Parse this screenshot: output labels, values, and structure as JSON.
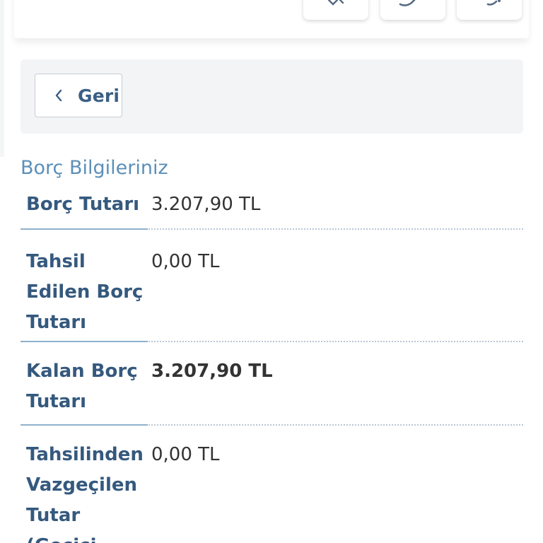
{
  "header": {
    "icons": [
      "star-icon",
      "chat-icon",
      "settings-icon"
    ]
  },
  "back": {
    "label": "Geri"
  },
  "section": {
    "title": "Borç Bilgileriniz"
  },
  "debt_rows": [
    {
      "label": "Borç Tutarı",
      "value": "3.207,90 TL",
      "emphasis": false
    },
    {
      "label": "Tahsil Edilen Borç Tutarı",
      "value": "0,00 TL",
      "emphasis": false
    },
    {
      "label": "Kalan Borç Tutarı",
      "value": "3.207,90 TL",
      "emphasis": true
    },
    {
      "label": "Tahsilinden Vazgeçilen Tutar (Gecici",
      "value": "0,00 TL",
      "emphasis": false
    }
  ],
  "colors": {
    "link_blue": "#5b8fb8",
    "label_blue": "#35597e",
    "panel_grey": "#f3f4f6"
  }
}
